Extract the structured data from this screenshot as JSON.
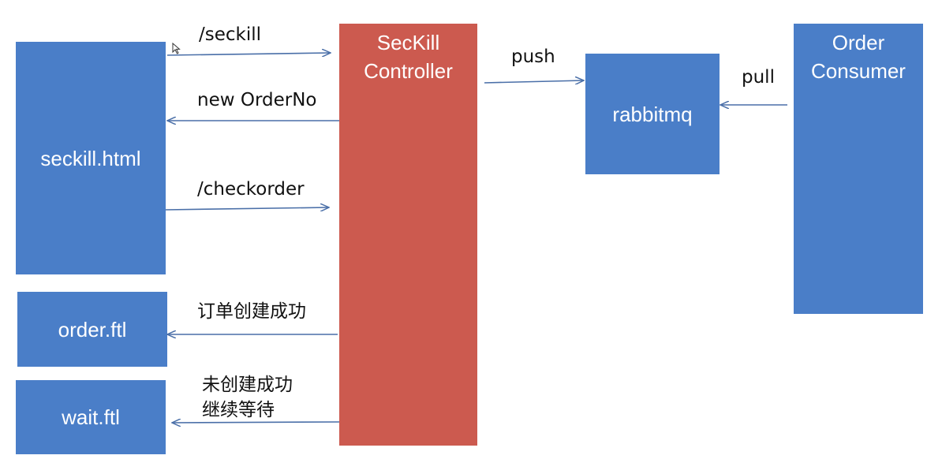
{
  "colors": {
    "box_blue": "#4a7ec8",
    "controller_red": "#cc5a4f",
    "arrow": "#4a6fa8"
  },
  "nodes": {
    "seckill_html": "seckill.html",
    "order_ftl": "order.ftl",
    "wait_ftl": "wait.ftl",
    "controller_line1": "SecKill",
    "controller_line2": "Controller",
    "rabbitmq": "rabbitmq",
    "consumer_line1": "Order",
    "consumer_line2": "Consumer"
  },
  "edges": {
    "seckill": "/seckill",
    "new_order_no": "new OrderNo",
    "checkorder": "/checkorder",
    "order_success": "订单创建成功",
    "not_created_line1": "未创建成功",
    "not_created_line2": "继续等待",
    "push": "push",
    "pull": "pull"
  }
}
